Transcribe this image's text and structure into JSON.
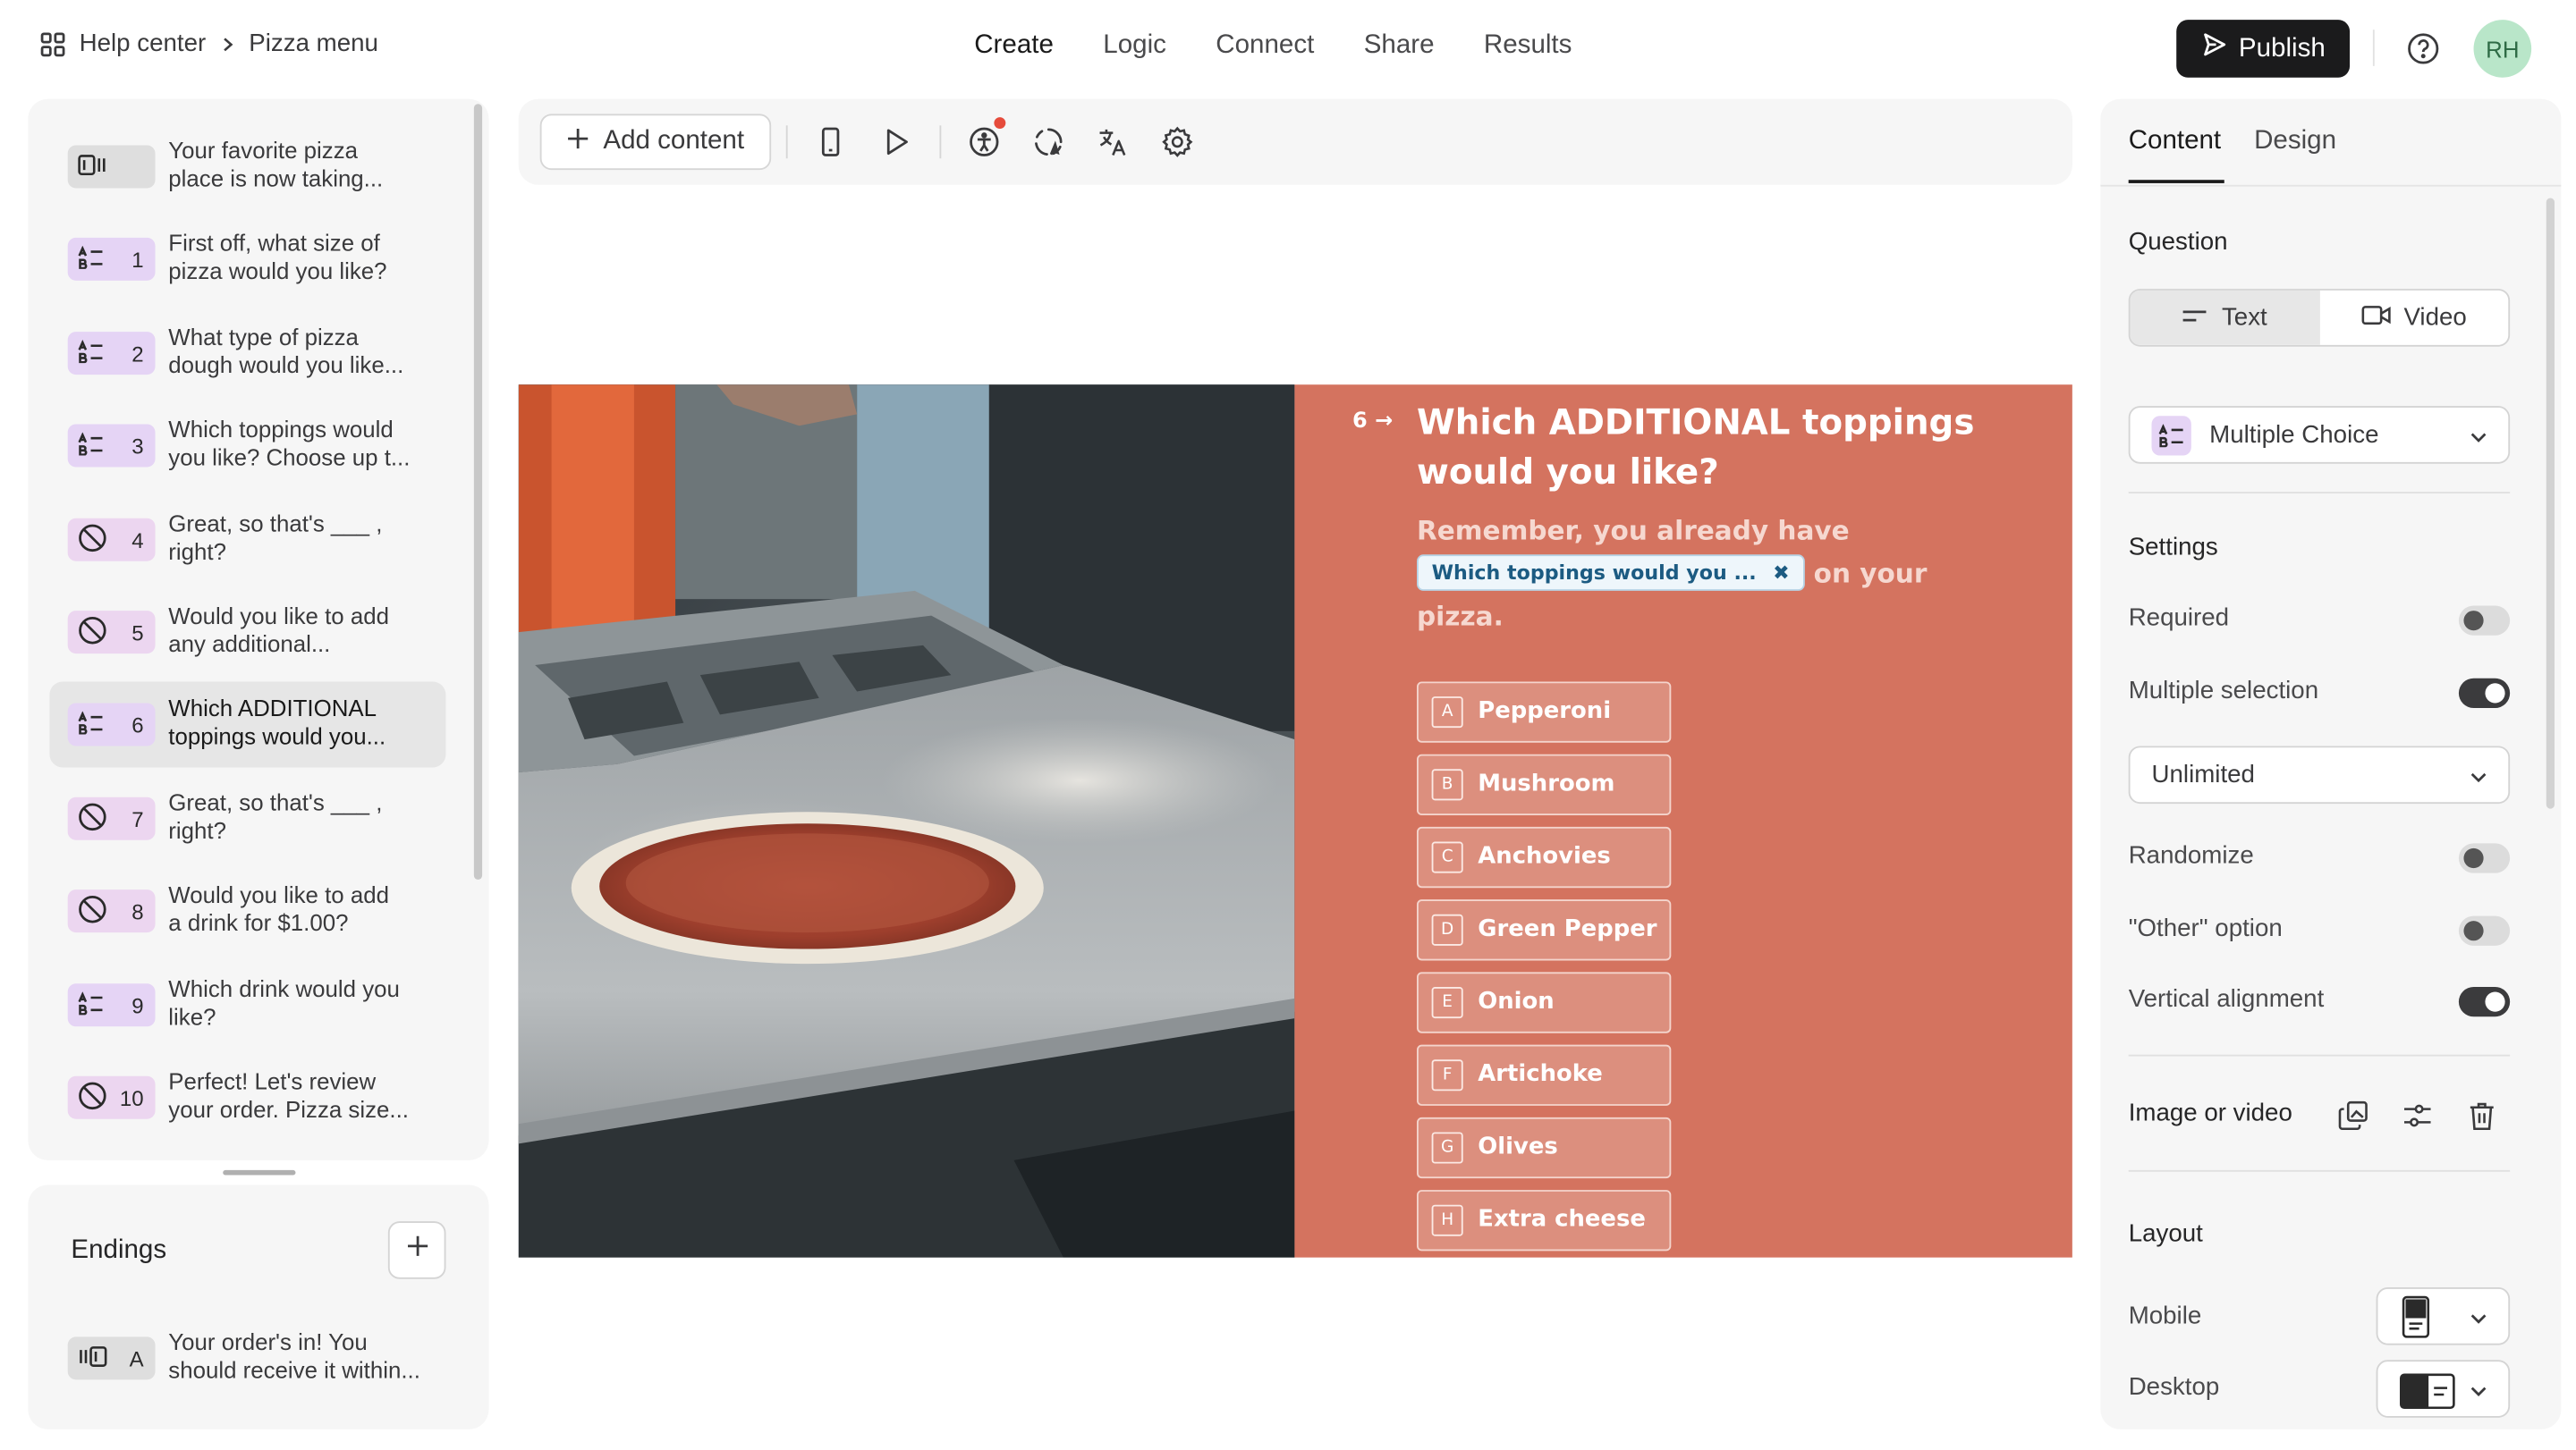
{
  "breadcrumb": {
    "root": "Help center",
    "current": "Pizza menu"
  },
  "nav": {
    "tabs": [
      "Create",
      "Logic",
      "Connect",
      "Share",
      "Results"
    ],
    "active": "Create"
  },
  "header": {
    "publish_label": "Publish",
    "avatar_initials": "RH"
  },
  "questions": [
    {
      "number": "",
      "type": "statement",
      "text": "Your favorite pizza\nplace is now taking..."
    },
    {
      "number": "1",
      "type": "multiple-choice",
      "text": "First off, what size of\npizza would you like?"
    },
    {
      "number": "2",
      "type": "multiple-choice",
      "text": "What type of pizza\ndough would you like..."
    },
    {
      "number": "3",
      "type": "multiple-choice",
      "text": "Which toppings would\nyou like? Choose up t..."
    },
    {
      "number": "4",
      "type": "yes-no",
      "text": "Great, so that's ___ ,\nright?"
    },
    {
      "number": "5",
      "type": "yes-no",
      "text": "Would you like to add\nany additional..."
    },
    {
      "number": "6",
      "type": "multiple-choice",
      "text": "Which ADDITIONAL\ntoppings would you...",
      "selected": true
    },
    {
      "number": "7",
      "type": "yes-no",
      "text": "Great, so that's ___ ,\nright?"
    },
    {
      "number": "8",
      "type": "yes-no",
      "text": "Would you like to add\na drink for $1.00?"
    },
    {
      "number": "9",
      "type": "multiple-choice",
      "text": "Which drink would you\nlike?"
    },
    {
      "number": "10",
      "type": "yes-no",
      "text": "Perfect! Let's review\nyour order. Pizza size..."
    }
  ],
  "endings": {
    "title": "Endings",
    "items": [
      {
        "number": "A",
        "text": "Your order's in! You\nshould receive it within..."
      }
    ]
  },
  "toolbar": {
    "add_content_label": "Add content"
  },
  "preview": {
    "number": "6",
    "title": "Which ADDITIONAL toppings would you like?",
    "subtitle_before": "Remember, you already have",
    "recall_chip": "Which toppings would you ...",
    "subtitle_after": "on your pizza.",
    "choices": [
      {
        "key": "A",
        "label": "Pepperoni"
      },
      {
        "key": "B",
        "label": "Mushroom"
      },
      {
        "key": "C",
        "label": "Anchovies"
      },
      {
        "key": "D",
        "label": "Green Pepper"
      },
      {
        "key": "E",
        "label": "Onion"
      },
      {
        "key": "F",
        "label": "Artichoke"
      },
      {
        "key": "G",
        "label": "Olives"
      },
      {
        "key": "H",
        "label": "Extra cheese"
      }
    ],
    "panel_color": "#d4735f"
  },
  "right_panel": {
    "tabs": [
      "Content",
      "Design"
    ],
    "active_tab": "Content",
    "question_heading": "Question",
    "question_modes": [
      "Text",
      "Video"
    ],
    "question_type": "Multiple Choice",
    "settings_heading": "Settings",
    "settings": [
      {
        "label": "Required",
        "on": false
      },
      {
        "label": "Multiple selection",
        "on": true
      },
      {
        "label": "Randomize",
        "on": false
      },
      {
        "label": "\"Other\" option",
        "on": false
      },
      {
        "label": "Vertical alignment",
        "on": true
      }
    ],
    "selection_limit": "Unlimited",
    "image_video_label": "Image or video",
    "layout_heading": "Layout",
    "layout_mobile_label": "Mobile",
    "layout_desktop_label": "Desktop"
  }
}
